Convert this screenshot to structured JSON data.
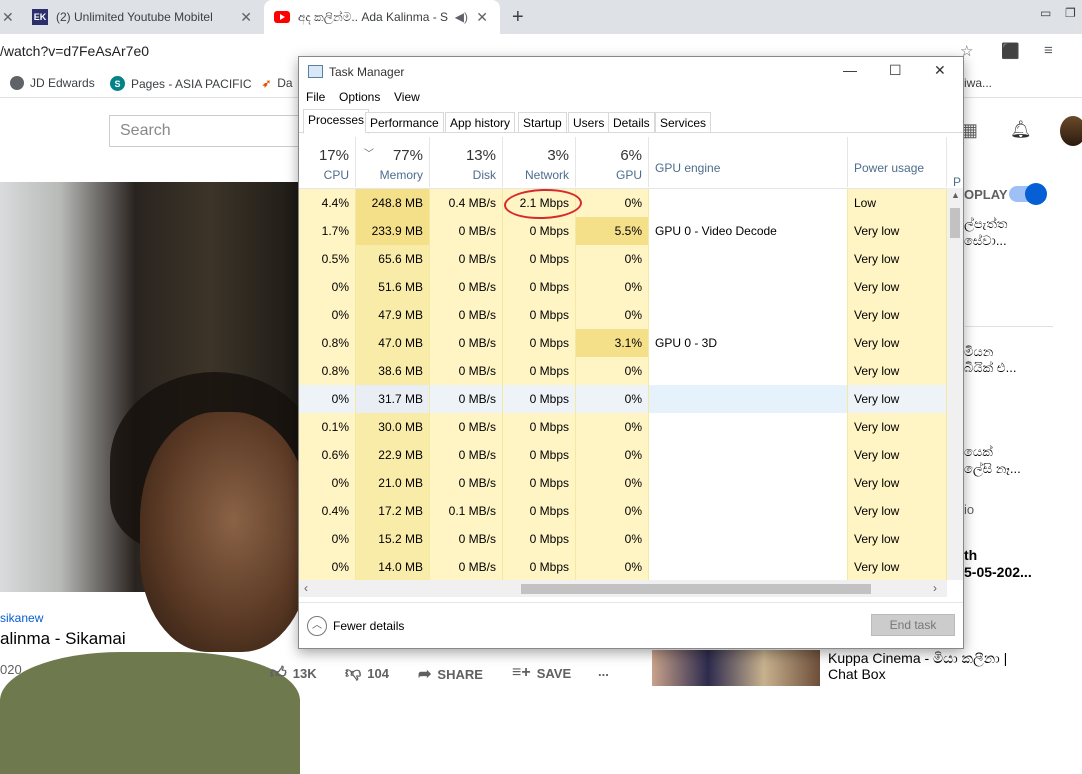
{
  "browser": {
    "tabs": [
      {
        "title": "(2) Unlimited Youtube Mobitel vs"
      },
      {
        "title": "අද කලින්ම.. Ada Kalinma - S"
      }
    ],
    "url": "/watch?v=d7FeAsAr7e0",
    "bookmarks": [
      {
        "label": "JD Edwards"
      },
      {
        "label": "Pages - ASIA PACIFIC"
      },
      {
        "label": "Da"
      }
    ],
    "bookmark_tail": "iwa..."
  },
  "youtube": {
    "search_placeholder": "Search",
    "autoplay_label": "OPLAY",
    "channel": "sikanew",
    "title": "alinma - Sikamai",
    "date": "020",
    "likes": "13K",
    "dislikes": "104",
    "share": "SHARE",
    "save": "SAVE",
    "more": "...",
    "sidebar_fragments": [
      "ල්පැත්ත",
      "සේවා...",
      "මියන",
      "බියික් එ...",
      "යෙක්",
      "ලේසි නෑ...",
      "io",
      "th",
      "5-05-202..."
    ],
    "rec_title_line1": "Kuppa Cinema - මියා කලීනා |",
    "rec_title_line2": "Chat Box"
  },
  "task_manager": {
    "title": "Task Manager",
    "menu": [
      "File",
      "Options",
      "View"
    ],
    "tabs": [
      "Processes",
      "Performance",
      "App history",
      "Startup",
      "Users",
      "Details",
      "Services"
    ],
    "columns": [
      {
        "pct": "17%",
        "label": "CPU"
      },
      {
        "pct": "77%",
        "label": "Memory"
      },
      {
        "pct": "13%",
        "label": "Disk"
      },
      {
        "pct": "3%",
        "label": "Network"
      },
      {
        "pct": "6%",
        "label": "GPU"
      },
      {
        "pct": "",
        "label": "GPU engine"
      },
      {
        "pct": "",
        "label": "Power usage"
      },
      {
        "pct": "",
        "label": "P"
      }
    ],
    "rows": [
      {
        "cpu": "4.4%",
        "mem": "248.8 MB",
        "disk": "0.4 MB/s",
        "net": "2.1 Mbps",
        "gpu": "0%",
        "engine": "",
        "power": "Low"
      },
      {
        "cpu": "1.7%",
        "mem": "233.9 MB",
        "disk": "0 MB/s",
        "net": "0 Mbps",
        "gpu": "5.5%",
        "engine": "GPU 0 - Video Decode",
        "power": "Very low"
      },
      {
        "cpu": "0.5%",
        "mem": "65.6 MB",
        "disk": "0 MB/s",
        "net": "0 Mbps",
        "gpu": "0%",
        "engine": "",
        "power": "Very low"
      },
      {
        "cpu": "0%",
        "mem": "51.6 MB",
        "disk": "0 MB/s",
        "net": "0 Mbps",
        "gpu": "0%",
        "engine": "",
        "power": "Very low"
      },
      {
        "cpu": "0%",
        "mem": "47.9 MB",
        "disk": "0 MB/s",
        "net": "0 Mbps",
        "gpu": "0%",
        "engine": "",
        "power": "Very low"
      },
      {
        "cpu": "0.8%",
        "mem": "47.0 MB",
        "disk": "0 MB/s",
        "net": "0 Mbps",
        "gpu": "3.1%",
        "engine": "GPU 0 - 3D",
        "power": "Very low"
      },
      {
        "cpu": "0.8%",
        "mem": "38.6 MB",
        "disk": "0 MB/s",
        "net": "0 Mbps",
        "gpu": "0%",
        "engine": "",
        "power": "Very low"
      },
      {
        "cpu": "0%",
        "mem": "31.7 MB",
        "disk": "0 MB/s",
        "net": "0 Mbps",
        "gpu": "0%",
        "engine": "",
        "power": "Very low"
      },
      {
        "cpu": "0.1%",
        "mem": "30.0 MB",
        "disk": "0 MB/s",
        "net": "0 Mbps",
        "gpu": "0%",
        "engine": "",
        "power": "Very low"
      },
      {
        "cpu": "0.6%",
        "mem": "22.9 MB",
        "disk": "0 MB/s",
        "net": "0 Mbps",
        "gpu": "0%",
        "engine": "",
        "power": "Very low"
      },
      {
        "cpu": "0%",
        "mem": "21.0 MB",
        "disk": "0 MB/s",
        "net": "0 Mbps",
        "gpu": "0%",
        "engine": "",
        "power": "Very low"
      },
      {
        "cpu": "0.4%",
        "mem": "17.2 MB",
        "disk": "0.1 MB/s",
        "net": "0 Mbps",
        "gpu": "0%",
        "engine": "",
        "power": "Very low"
      },
      {
        "cpu": "0%",
        "mem": "15.2 MB",
        "disk": "0 MB/s",
        "net": "0 Mbps",
        "gpu": "0%",
        "engine": "",
        "power": "Very low"
      },
      {
        "cpu": "0%",
        "mem": "14.0 MB",
        "disk": "0 MB/s",
        "net": "0 Mbps",
        "gpu": "0%",
        "engine": "",
        "power": "Very low"
      }
    ],
    "fewer_details": "Fewer details",
    "end_task": "End task",
    "colors": {
      "heat_light": "#fff4c4",
      "heat_mid": "#f9eca8",
      "heat_strong": "#f5e08a",
      "selected_row": "#e5f1fb",
      "annotation": "#d62a2a"
    }
  }
}
